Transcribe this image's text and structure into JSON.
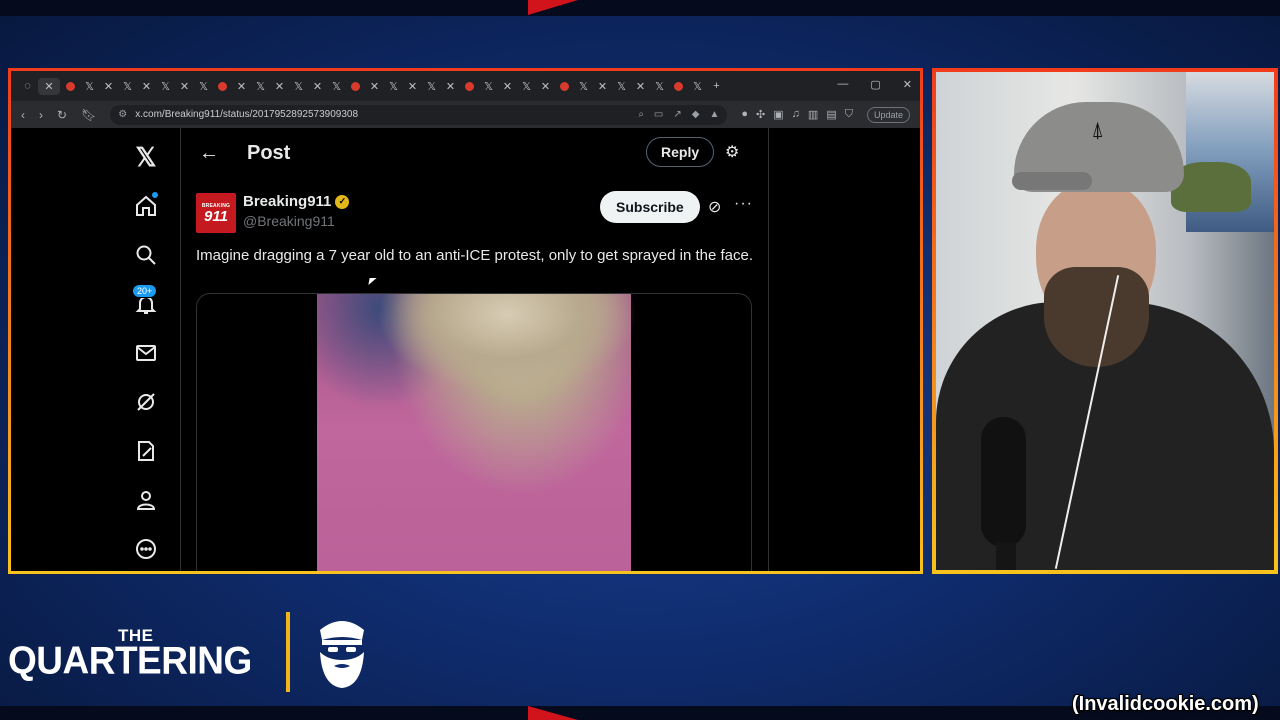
{
  "browser": {
    "url": "x.com/Breaking911/status/2017952892573909308",
    "update_label": "Update"
  },
  "x_nav": {
    "notifications_badge": "20+"
  },
  "post_header": {
    "title": "Post",
    "reply_label": "Reply"
  },
  "tweet": {
    "author_name": "Breaking911",
    "author_handle": "@Breaking911",
    "avatar_small": "BREAKING",
    "avatar_big": "911",
    "subscribe_label": "Subscribe",
    "text": "Imagine dragging  a 7 year old to an anti-ICE protest, only to get sprayed in the face."
  },
  "overlay": {
    "logo_top": "THE",
    "logo_main": "QUARTERING",
    "credit": "(Invalidcookie.com)"
  },
  "colors": {
    "frame_top": "#f03c1c",
    "frame_bottom": "#f8c21d",
    "background": "#0f2c6e",
    "x_blue": "#1d9bf0"
  }
}
